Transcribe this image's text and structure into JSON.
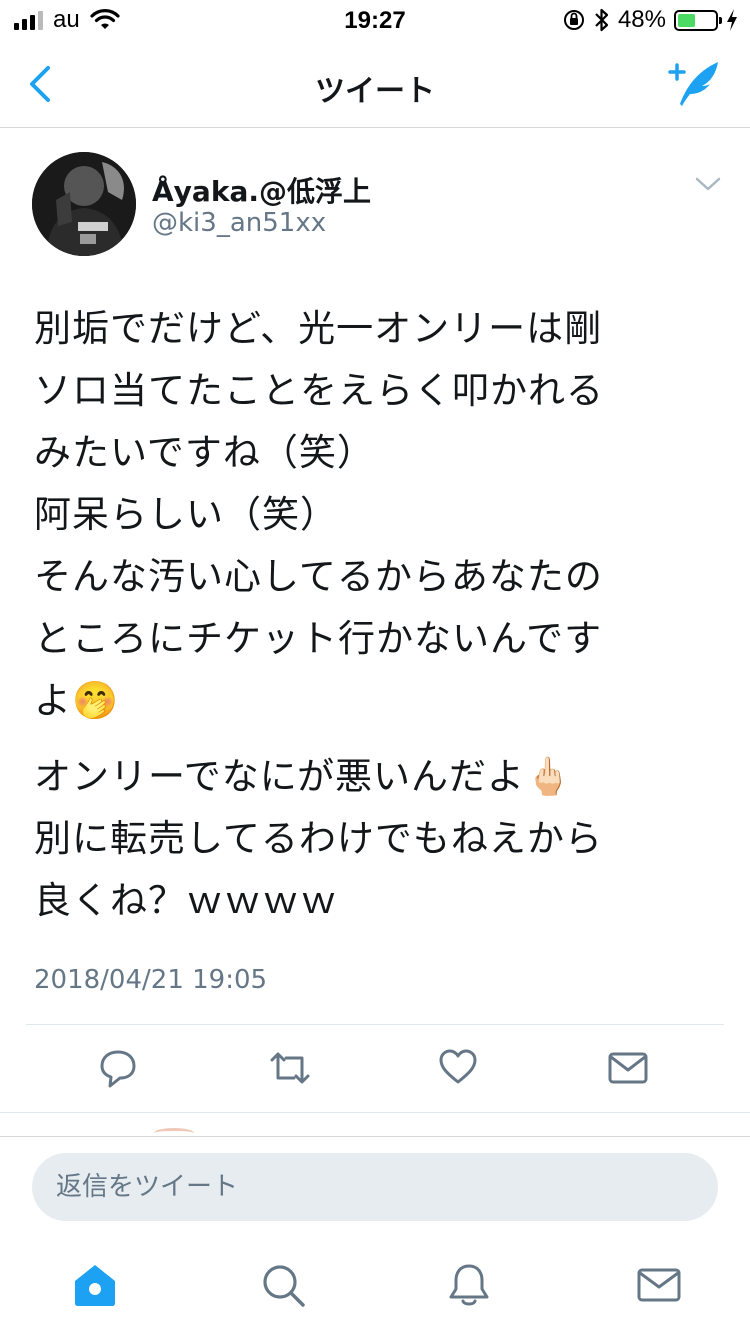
{
  "status_bar": {
    "carrier": "au",
    "time": "19:27",
    "battery_percent": "48%",
    "battery_level": 0.48,
    "icons": [
      "signal-bars",
      "wifi-icon",
      "orientation-lock-icon",
      "bluetooth-icon",
      "battery-icon",
      "charging-bolt-icon"
    ]
  },
  "nav": {
    "title": "ツイート",
    "back_icon": "chevron-left-icon",
    "compose_icon": "compose-tweet-icon"
  },
  "tweet": {
    "display_name": "Åyaka.@低浮上",
    "handle": "@ki3_an51xx",
    "lines": [
      "別垢でだけど、光一オンリーは剛",
      "ソロ当てたことをえらく叩かれる",
      "みたいですね（笑）",
      "阿呆らしい（笑）",
      "そんな汚い心してるからあなたの",
      "ところにチケット行かないんです",
      "よ🤭"
    ],
    "lines2": [
      "オンリーでなにが悪いんだよ🖕🏻",
      "別に転売してるわけでもねえから",
      "良くね？ｗｗｗｗ"
    ],
    "timestamp": "2018/04/21 19:05"
  },
  "actions": [
    "reply-icon",
    "retweet-icon",
    "like-icon",
    "direct-message-icon"
  ],
  "reply": {
    "placeholder": "返信をツイート"
  },
  "tabs": [
    "home-icon",
    "search-icon",
    "notifications-icon",
    "messages-icon"
  ],
  "colors": {
    "accent": "#1da1f2",
    "text": "#14171a",
    "secondary": "#657786",
    "battery": "#4cd964"
  }
}
